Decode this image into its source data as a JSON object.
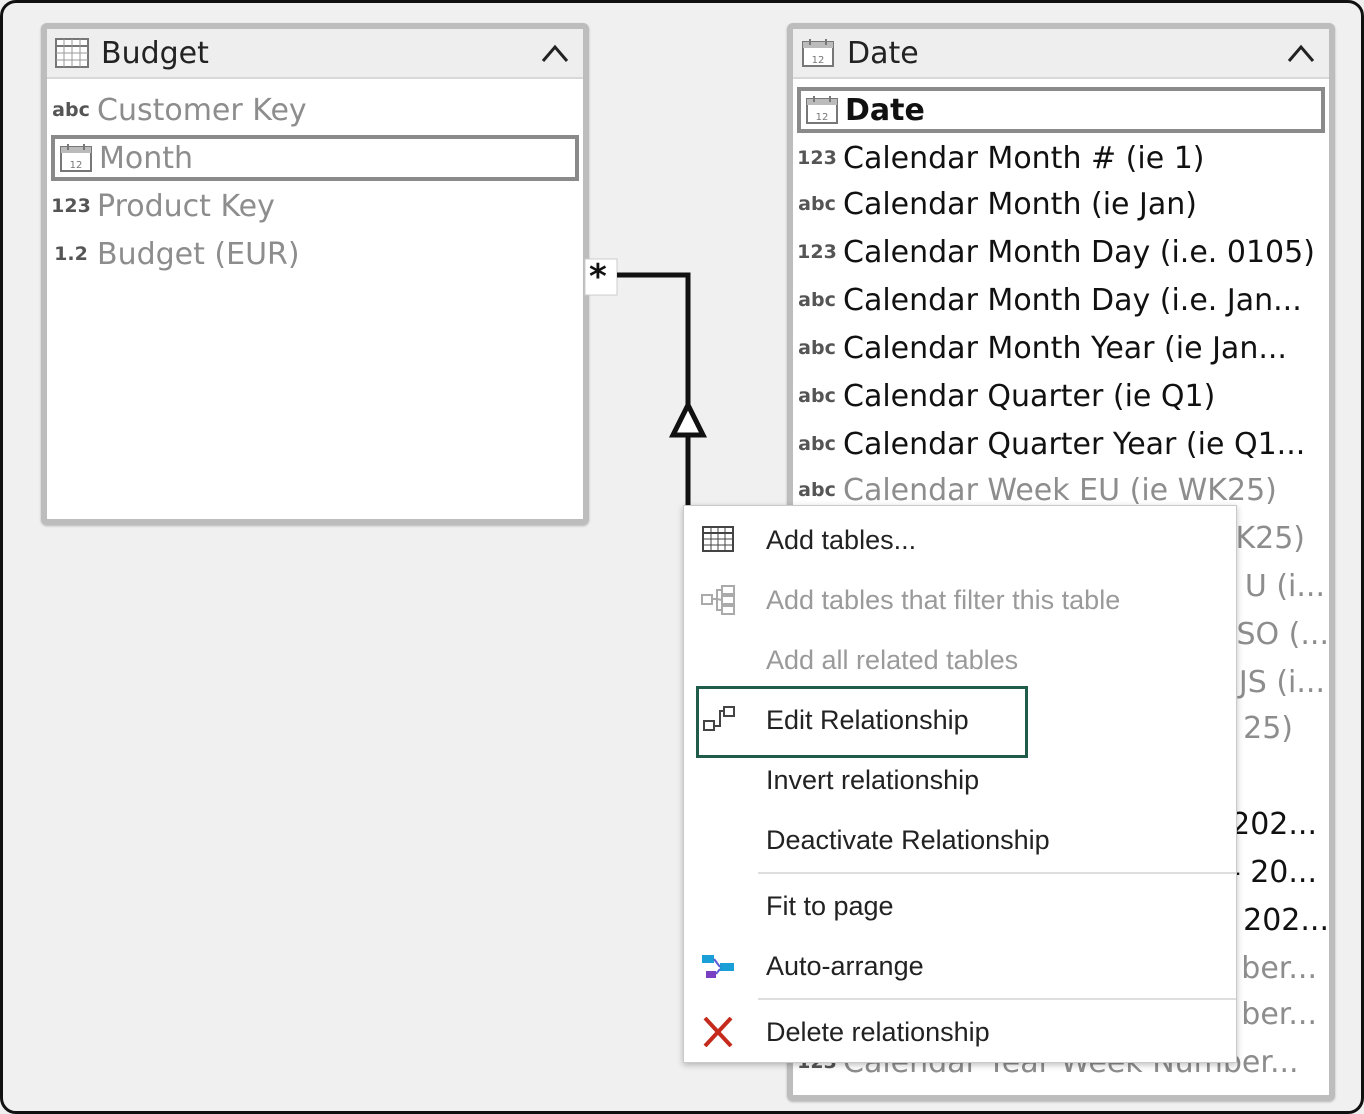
{
  "budget_table": {
    "title": "Budget",
    "columns": [
      {
        "type": "abc",
        "name": "Customer Key"
      },
      {
        "type": "calendar",
        "name": "Month"
      },
      {
        "type": "123",
        "name": "Product Key"
      },
      {
        "type": "1.2",
        "name": "Budget (EUR)"
      }
    ]
  },
  "date_table": {
    "title": "Date",
    "columns": [
      {
        "type": "calendar",
        "name": "Date"
      },
      {
        "type": "123",
        "name": "Calendar Month # (ie 1)"
      },
      {
        "type": "abc",
        "name": "Calendar Month (ie Jan)"
      },
      {
        "type": "123",
        "name": "Calendar Month Day (i.e. 0105)"
      },
      {
        "type": "abc",
        "name": "Calendar Month Day (i.e. Jan..."
      },
      {
        "type": "abc",
        "name": "Calendar Month Year (ie Jan..."
      },
      {
        "type": "abc",
        "name": "Calendar Quarter (ie Q1)"
      },
      {
        "type": "abc",
        "name": "Calendar Quarter Year (ie Q1..."
      },
      {
        "type": "abc",
        "name": "Calendar Week EU (ie WK25)"
      },
      {
        "type": "",
        "name": "K25)"
      },
      {
        "type": "",
        "name": "U (i..."
      },
      {
        "type": "",
        "name": "SO (..."
      },
      {
        "type": "",
        "name": "JS (i..."
      },
      {
        "type": "",
        "name": "25)"
      },
      {
        "type": "",
        "name": ""
      },
      {
        "type": "",
        "name": "202..."
      },
      {
        "type": "",
        "name": "- 20..."
      },
      {
        "type": "",
        "name": "202..."
      },
      {
        "type": "",
        "name": "ber..."
      },
      {
        "type": "",
        "name": "ber..."
      },
      {
        "type": "123",
        "name": "Calendar Year Week Number..."
      }
    ]
  },
  "relationship": {
    "many_marker": "*"
  },
  "context_menu": {
    "items": [
      {
        "label": "Add tables...",
        "icon": "table-grid-icon",
        "enabled": true
      },
      {
        "label": "Add tables that filter this table",
        "icon": "filter-tables-icon",
        "enabled": false
      },
      {
        "label": "Add all related tables",
        "icon": "",
        "enabled": false
      },
      {
        "label": "Edit Relationship",
        "icon": "edit-relationship-icon",
        "enabled": true,
        "focused": true
      },
      {
        "label": "Invert relationship",
        "icon": "",
        "enabled": true
      },
      {
        "label": "Deactivate Relationship",
        "icon": "",
        "enabled": true
      },
      {
        "label": "Fit to page",
        "icon": "",
        "enabled": true
      },
      {
        "label": "Auto-arrange",
        "icon": "auto-arrange-icon",
        "enabled": true
      },
      {
        "label": "Delete relationship",
        "icon": "delete-x-icon",
        "enabled": true
      }
    ]
  },
  "colors": {
    "focus_outline": "#1f5c4a",
    "delete_icon": "#c42b1c",
    "auto_arrange_icon": "#1a9fd6"
  }
}
